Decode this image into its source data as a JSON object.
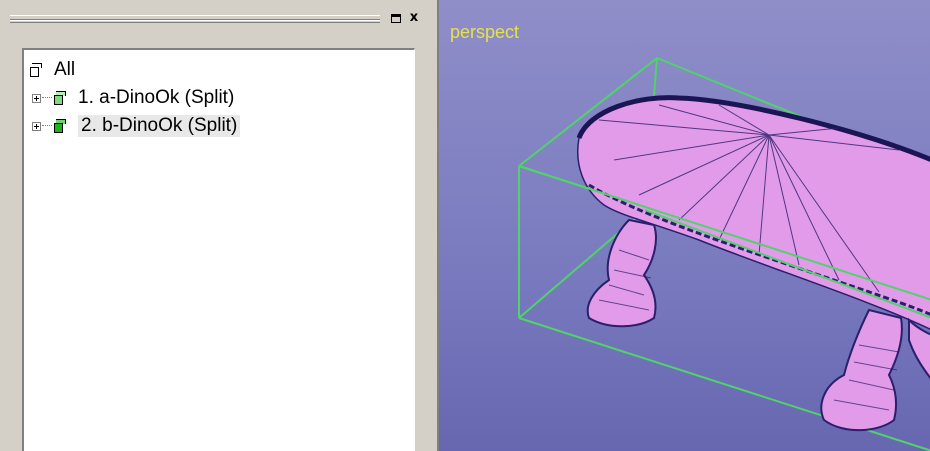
{
  "panel": {
    "restore_icon": "restore-window-icon",
    "close_icon": "close-x-icon",
    "close_glyph": "x"
  },
  "tree": {
    "root": {
      "label": "All",
      "icon": "layer-group-icon"
    },
    "items": [
      {
        "label": "1. a-DinoOk (Split)",
        "icon": "layer-cube-light-green-icon",
        "color": "#7ddc7d"
      },
      {
        "label": "2. b-DinoOk (Split)",
        "icon": "layer-cube-dark-green-icon",
        "color": "#1eb41e",
        "selected": true
      }
    ]
  },
  "viewport": {
    "label": "perspect",
    "label_color": "#e6e24a",
    "background_color": "#7b7cc0",
    "bbox_color": "#4fd36a",
    "mesh_color": "#e29be8"
  }
}
